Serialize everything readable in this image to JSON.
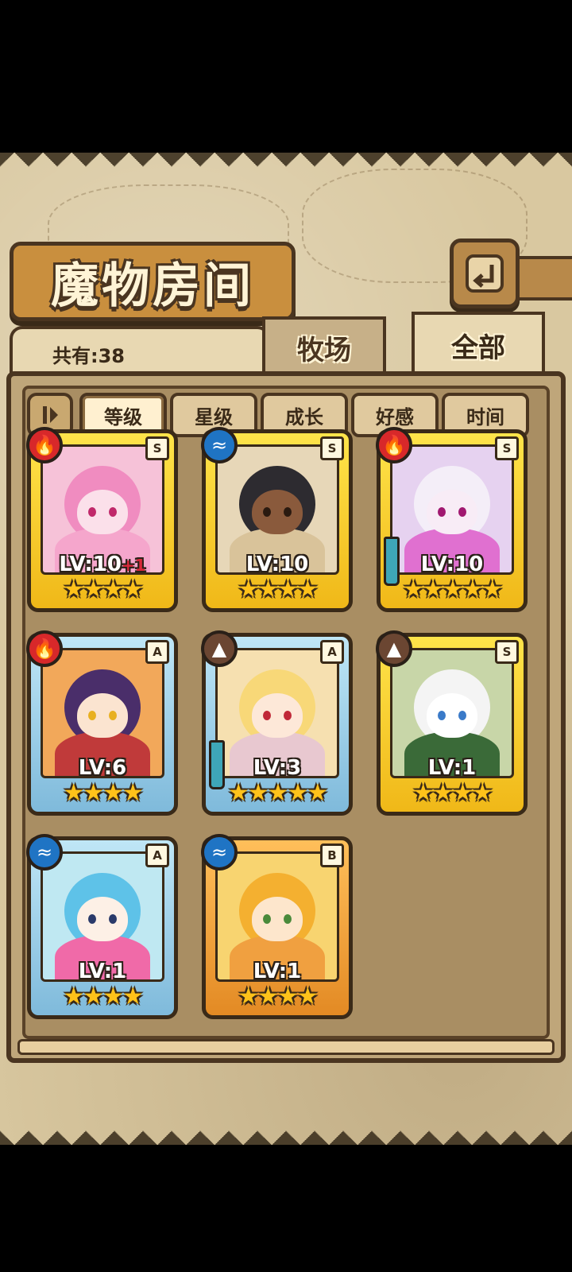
{
  "header": {
    "title": "魔物房间",
    "back_icon": "back-arrow-icon",
    "total_label": "共有:38"
  },
  "tabs": [
    {
      "label": "牧场",
      "active": false
    },
    {
      "label": "全部",
      "active": true
    }
  ],
  "sort": {
    "toggle_icon": "sort-order-icon",
    "options": [
      {
        "label": "等级",
        "active": true
      },
      {
        "label": "星级",
        "active": false
      },
      {
        "label": "成长",
        "active": false
      },
      {
        "label": "好感",
        "active": false
      },
      {
        "label": "时间",
        "active": false
      }
    ]
  },
  "monsters": [
    {
      "element": "fire",
      "rank": "S",
      "level": "LV:10",
      "bonus": "+1",
      "stars": 4,
      "weapon": false,
      "palette": "pink"
    },
    {
      "element": "water",
      "rank": "S",
      "level": "LV:10",
      "bonus": "",
      "stars": 4,
      "weapon": false,
      "palette": "dark"
    },
    {
      "element": "fire",
      "rank": "S",
      "level": "LV:10",
      "bonus": "",
      "stars": 5,
      "weapon": true,
      "palette": "violet"
    },
    {
      "element": "fire",
      "rank": "A",
      "level": "LV:6",
      "bonus": "",
      "stars": 4,
      "weapon": false,
      "palette": "purple"
    },
    {
      "element": "earth",
      "rank": "A",
      "level": "LV:3",
      "bonus": "",
      "stars": 5,
      "weapon": true,
      "palette": "blonde"
    },
    {
      "element": "earth",
      "rank": "S",
      "level": "LV:1",
      "bonus": "",
      "stars": 4,
      "weapon": false,
      "palette": "panda"
    },
    {
      "element": "water",
      "rank": "A",
      "level": "LV:1",
      "bonus": "",
      "stars": 4,
      "weapon": false,
      "palette": "cyan"
    },
    {
      "element": "water",
      "rank": "B",
      "level": "LV:1",
      "bonus": "",
      "stars": 4,
      "weapon": false,
      "palette": "orange"
    }
  ],
  "element_icons": {
    "fire": "fire-icon",
    "water": "water-waves-icon",
    "earth": "mountain-icon"
  },
  "colors": {
    "frame": "#4a3520",
    "gold": "#ffc21a",
    "rank_S": "#f0b818",
    "rank_A": "#7fbadb",
    "rank_B": "#e38a24"
  }
}
